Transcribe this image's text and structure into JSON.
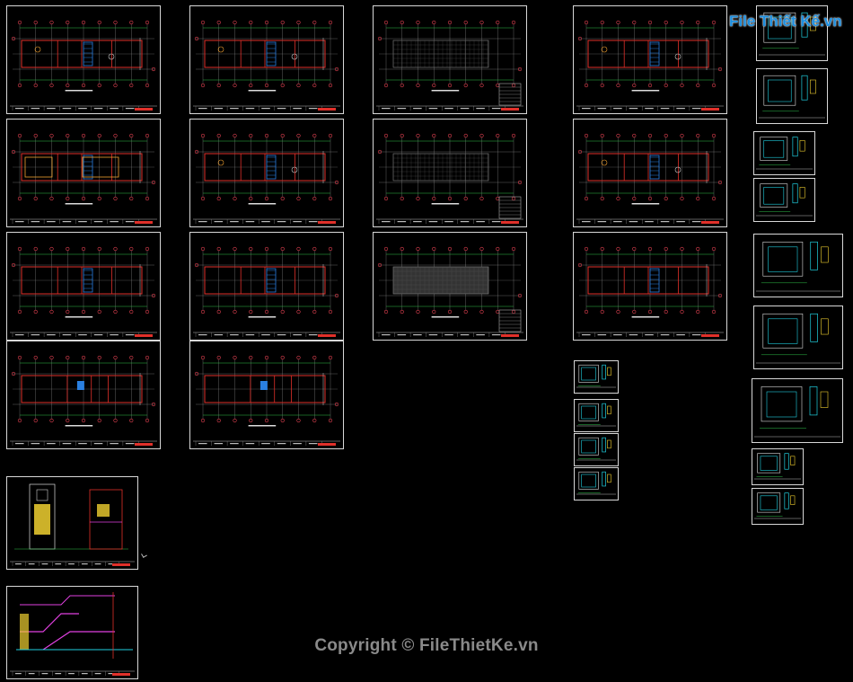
{
  "app": {
    "kind": "CAD drawing layout preview"
  },
  "watermark": {
    "text": "Copyright © FileThietKe.vn"
  },
  "logo": {
    "text": "File Thiết Kế.vn",
    "color": "#1d8fe0"
  },
  "colors": {
    "background": "#000000",
    "frame": "#d8d8d8",
    "wall": "#e0302a",
    "grid": "#8a8a8a",
    "dim": "#2fbf4a",
    "bubble": "#e04050",
    "furniture": "#f0a030",
    "stair": "#2a7fe0",
    "section_yellow": "#f0d030",
    "section_magenta": "#e040e0",
    "section_cyan": "#20d0e0"
  },
  "sheets": [
    {
      "id": "plan-1",
      "type": "plan"
    },
    {
      "id": "plan-2",
      "type": "plan"
    },
    {
      "id": "plan-3",
      "type": "plan-grid"
    },
    {
      "id": "plan-4",
      "type": "plan"
    },
    {
      "id": "plan-5",
      "type": "plan-furnished"
    },
    {
      "id": "plan-6",
      "type": "plan"
    },
    {
      "id": "plan-7",
      "type": "plan-grid"
    },
    {
      "id": "plan-8",
      "type": "plan"
    },
    {
      "id": "plan-9",
      "type": "plan-open"
    },
    {
      "id": "plan-10",
      "type": "plan-open"
    },
    {
      "id": "plan-11",
      "type": "plan-dark"
    },
    {
      "id": "plan-12",
      "type": "plan-open"
    },
    {
      "id": "plan-13",
      "type": "roof"
    },
    {
      "id": "plan-14",
      "type": "roof"
    },
    {
      "id": "elevation-1",
      "type": "elevation"
    },
    {
      "id": "section-1",
      "type": "section"
    },
    {
      "id": "detail-1",
      "type": "detail"
    },
    {
      "id": "detail-2",
      "type": "detail"
    },
    {
      "id": "detail-3",
      "type": "detail"
    },
    {
      "id": "detail-4",
      "type": "detail"
    },
    {
      "id": "detail-5",
      "type": "detail"
    },
    {
      "id": "detail-6",
      "type": "detail"
    },
    {
      "id": "detail-7",
      "type": "detail"
    },
    {
      "id": "detail-8",
      "type": "detail"
    },
    {
      "id": "detail-9",
      "type": "detail"
    },
    {
      "id": "detail-10",
      "type": "detail"
    },
    {
      "id": "detail-11",
      "type": "detail"
    },
    {
      "id": "detail-12",
      "type": "detail"
    },
    {
      "id": "detail-13",
      "type": "detail"
    },
    {
      "id": "detail-14",
      "type": "detail"
    }
  ]
}
